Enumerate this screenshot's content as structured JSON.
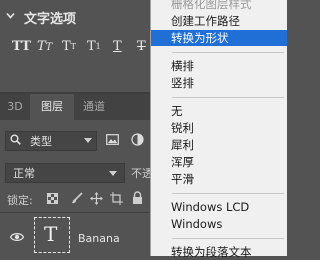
{
  "character_panel": {
    "title": "文字选项",
    "type_buttons": {
      "faux_bold": "TT",
      "faux_italic": "T",
      "faux_italic_suffix": "T",
      "all_caps": "T",
      "all_caps_mark": "T",
      "small_caps": "T",
      "small_caps_mark": "1",
      "underline": "T",
      "strikethrough": "T"
    }
  },
  "layers_panel": {
    "tabs": [
      "3D",
      "图层",
      "通道"
    ],
    "active_tab": "图层",
    "filter": {
      "label": "类型"
    },
    "blend_mode": "正常",
    "opacity_label_partial": "不透",
    "lock_label": "锁定:",
    "layer": {
      "name": "Banana",
      "thumbnail_glyph": "T"
    }
  },
  "context_menu": {
    "items": [
      {
        "label": "栅格化图层样式",
        "disabled": true
      },
      {
        "label": "创建工作路径"
      },
      {
        "label": "转换为形状",
        "highlighted": true
      },
      {
        "label": "横排"
      },
      {
        "label": "竖排"
      },
      {
        "label": "无"
      },
      {
        "label": "锐利"
      },
      {
        "label": "犀利"
      },
      {
        "label": "浑厚"
      },
      {
        "label": "平滑"
      },
      {
        "label": "Windows LCD"
      },
      {
        "label": "Windows"
      },
      {
        "label": "转换为段落文本"
      }
    ],
    "highlight_color": "#1f6fd6"
  }
}
